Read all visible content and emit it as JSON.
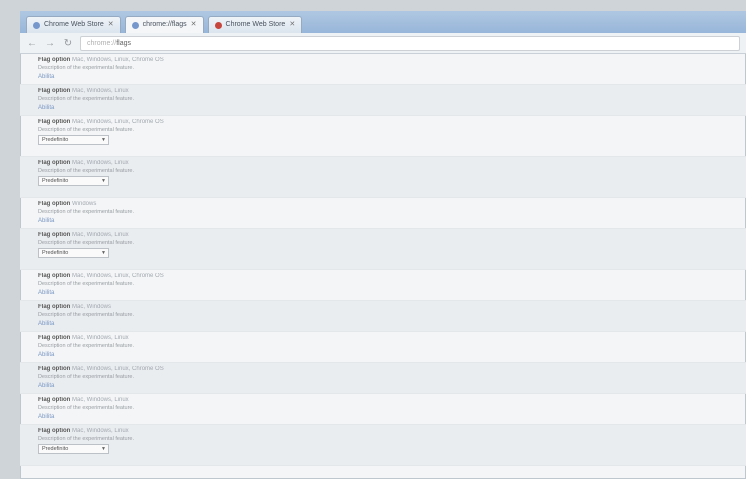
{
  "browser": {
    "tabs": [
      {
        "label": "Chrome Web Store",
        "active": false
      },
      {
        "label": "chrome://flags",
        "active": true
      },
      {
        "label": "Chrome Web Store",
        "active": false
      }
    ],
    "url_scheme": "chrome://",
    "url_path": "flags"
  },
  "flags": [
    {
      "title": "Flag option",
      "meta": "Mac, Windows, Linux, Chrome OS",
      "desc": "Description of the experimental feature.",
      "action": "Abilita",
      "kind": "link"
    },
    {
      "title": "Flag option",
      "meta": "Mac, Windows, Linux",
      "desc": "Description of the experimental feature.",
      "action": "Abilita",
      "kind": "link"
    },
    {
      "title": "Flag option",
      "meta": "Mac, Windows, Linux, Chrome OS",
      "desc": "Description of the experimental feature.",
      "action": "Predefinito",
      "kind": "select"
    },
    {
      "title": "Flag option",
      "meta": "Mac, Windows, Linux",
      "desc": "Description of the experimental feature.",
      "action": "Predefinito",
      "kind": "select"
    },
    {
      "title": "Flag option",
      "meta": "Windows",
      "desc": "Description of the experimental feature.",
      "action": "Abilita",
      "kind": "link"
    },
    {
      "title": "Flag option",
      "meta": "Mac, Windows, Linux",
      "desc": "Description of the experimental feature.",
      "action": "Predefinito",
      "kind": "select"
    },
    {
      "title": "Flag option",
      "meta": "Mac, Windows, Linux, Chrome OS",
      "desc": "Description of the experimental feature.",
      "action": "Abilita",
      "kind": "link"
    },
    {
      "title": "Flag option",
      "meta": "Mac, Windows",
      "desc": "Description of the experimental feature.",
      "action": "Abilita",
      "kind": "link"
    },
    {
      "title": "Flag option",
      "meta": "Mac, Windows, Linux",
      "desc": "Description of the experimental feature.",
      "action": "Abilita",
      "kind": "link"
    },
    {
      "title": "Flag option",
      "meta": "Mac, Windows, Linux, Chrome OS",
      "desc": "Description of the experimental feature.",
      "action": "Abilita",
      "kind": "link"
    },
    {
      "title": "Flag option",
      "meta": "Mac, Windows, Linux",
      "desc": "Description of the experimental feature.",
      "action": "Abilita",
      "kind": "link"
    },
    {
      "title": "Flag option",
      "meta": "Mac, Windows, Linux",
      "desc": "Description of the experimental feature.",
      "action": "Predefinito",
      "kind": "select"
    }
  ]
}
